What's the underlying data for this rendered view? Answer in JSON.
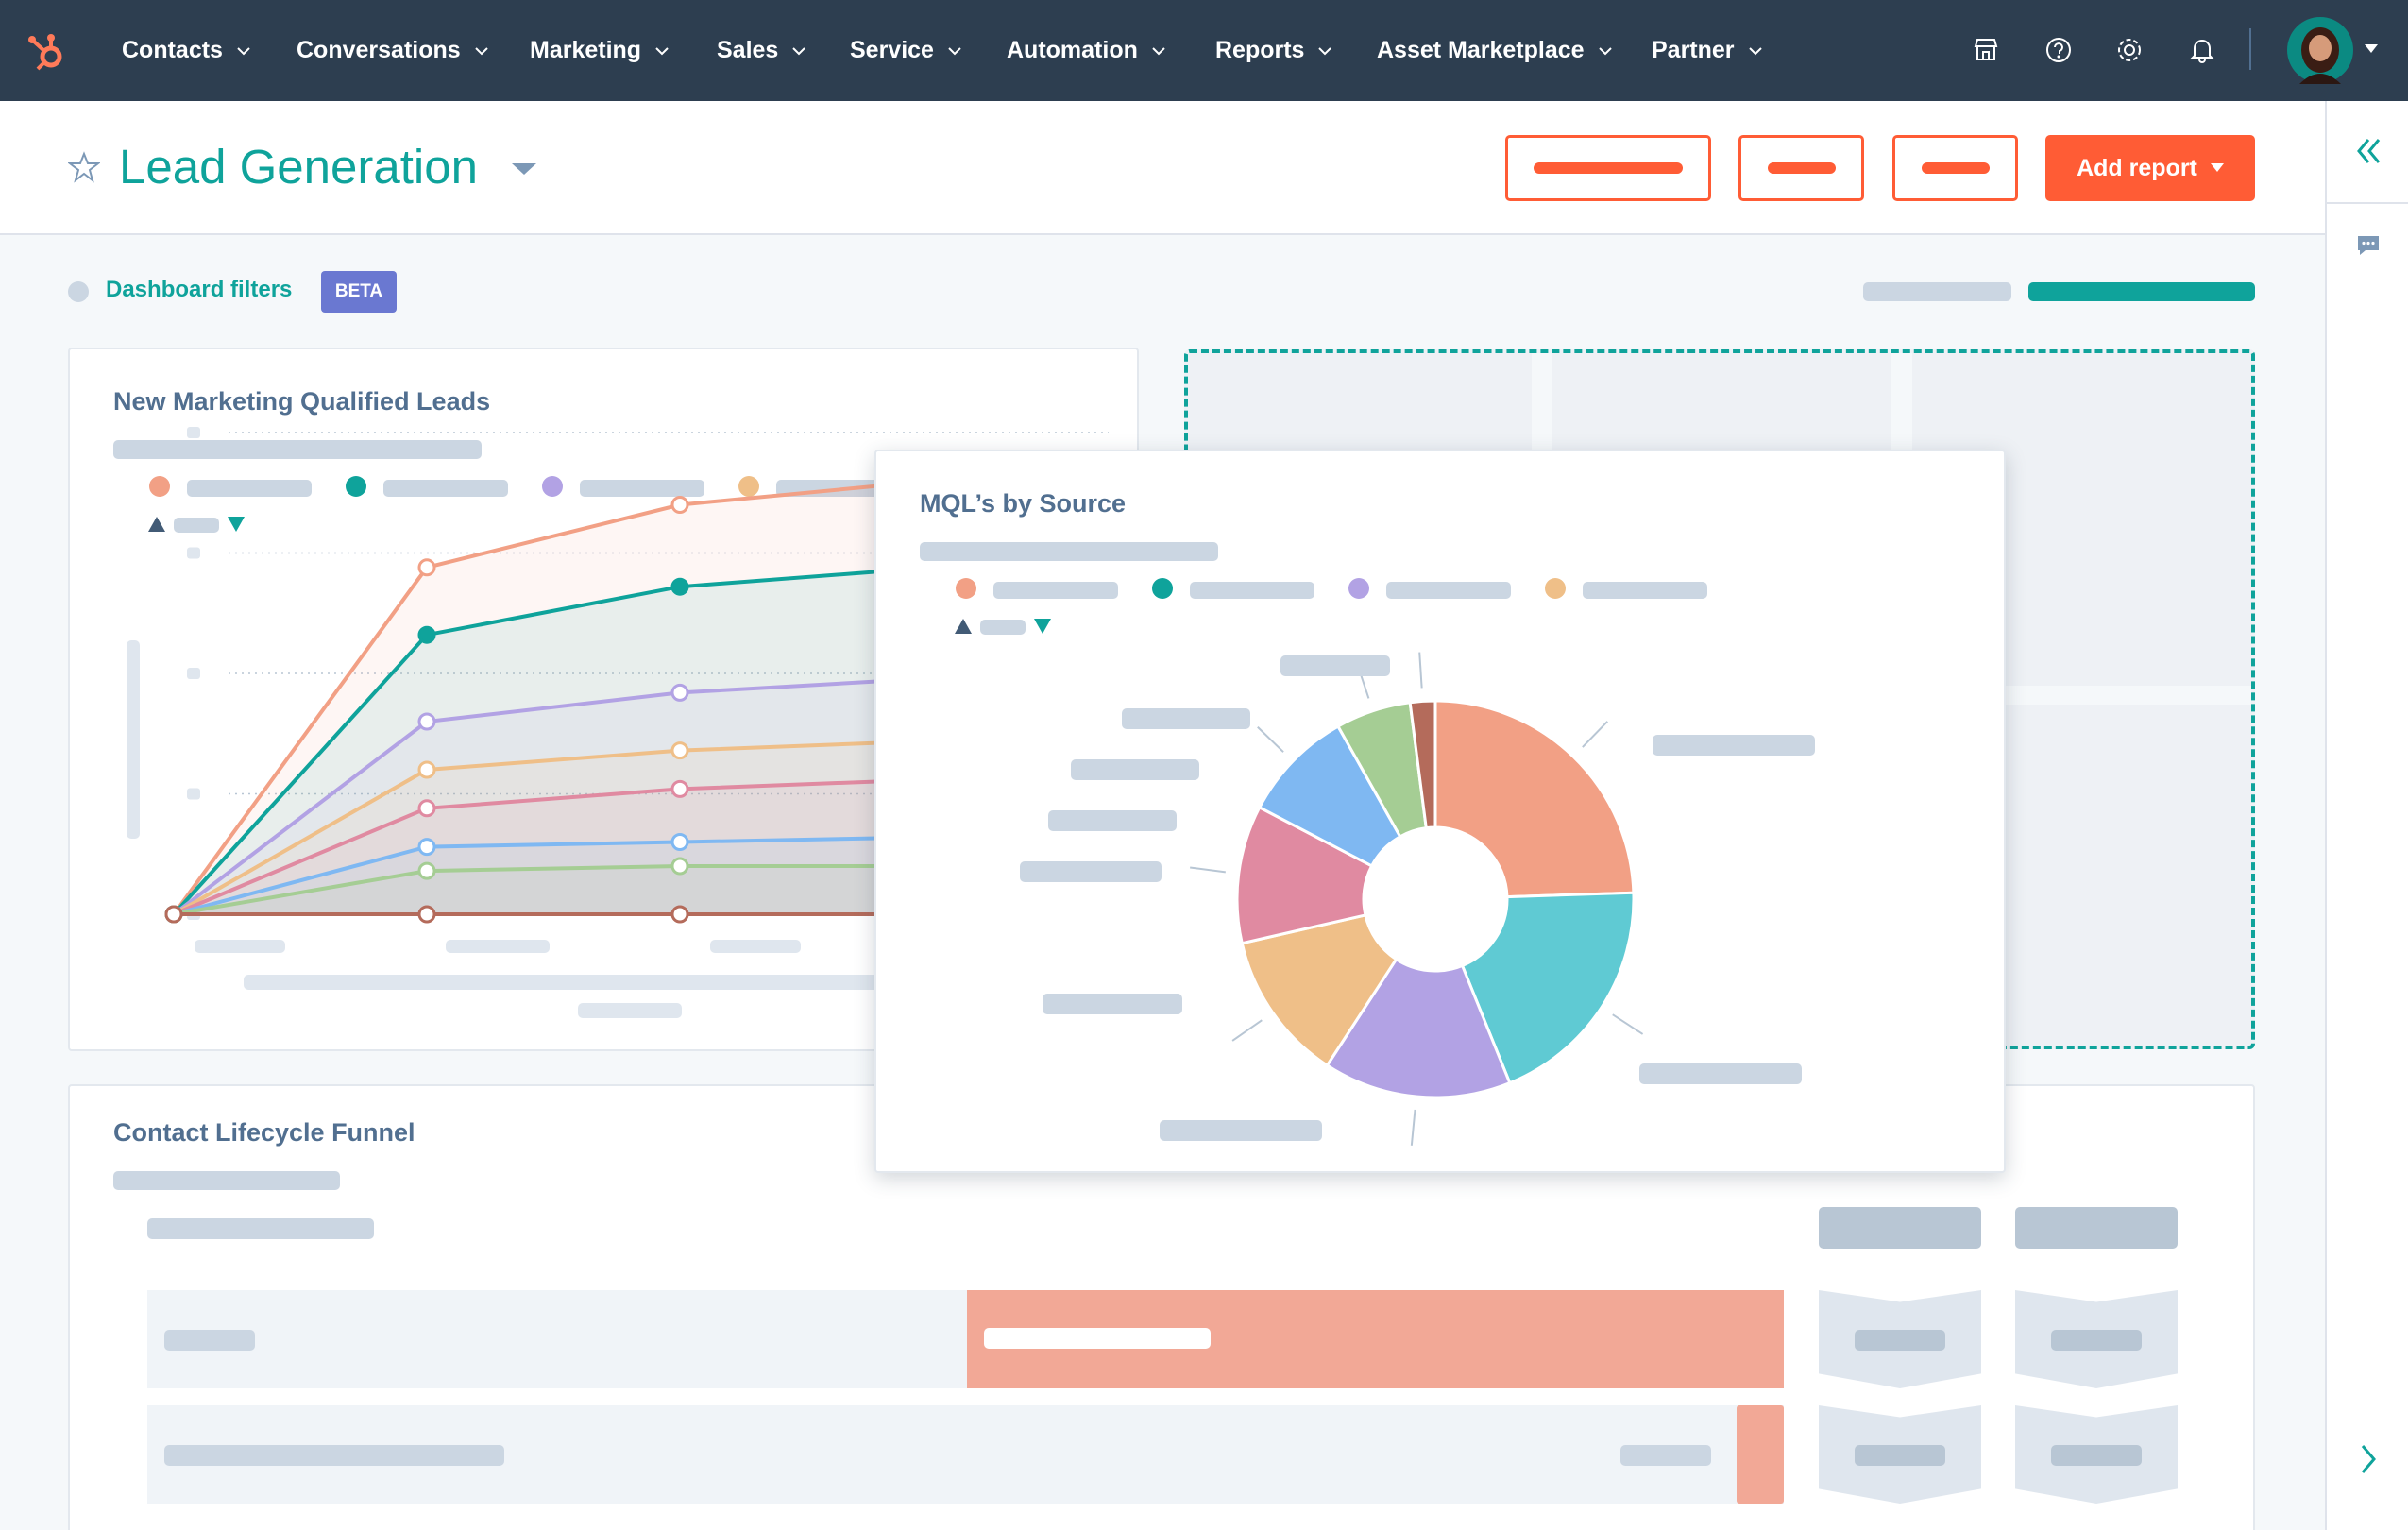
{
  "nav": {
    "items": [
      "Contacts",
      "Conversations",
      "Marketing",
      "Sales",
      "Service",
      "Automation",
      "Reports",
      "Asset Marketplace",
      "Partner"
    ],
    "icons": [
      "marketplace-icon",
      "help-icon",
      "settings-icon",
      "notifications-icon"
    ]
  },
  "header": {
    "title": "Lead Generation",
    "add_report_label": "Add report"
  },
  "filters": {
    "label": "Dashboard filters",
    "badge": "BETA"
  },
  "cards": {
    "mql_trend_title": "New Marketing Qualified Leads",
    "mql_source_title": "MQL’s by Source",
    "funnel_title": "Contact Lifecycle Funnel"
  },
  "colors": {
    "nav_bg": "#2d3e50",
    "accent_teal": "#0fa39b",
    "accent_orange": "#ff5c35",
    "badge": "#6a78d1"
  },
  "chart_data": [
    {
      "type": "line",
      "x": [
        0,
        1,
        2,
        3
      ],
      "series": [
        {
          "color": "#f2a085",
          "values": [
            0,
            72,
            85,
            90
          ]
        },
        {
          "color": "#0fa39b",
          "values": [
            0,
            58,
            68,
            72
          ]
        },
        {
          "color": "#b2a2e4",
          "values": [
            0,
            40,
            46,
            49
          ]
        },
        {
          "color": "#efbf88",
          "values": [
            0,
            30,
            34,
            36
          ]
        },
        {
          "color": "#e08aa1",
          "values": [
            0,
            22,
            26,
            28
          ]
        },
        {
          "color": "#7fb8f2",
          "values": [
            0,
            14,
            15,
            16
          ]
        },
        {
          "color": "#a5cd94",
          "values": [
            0,
            9,
            10,
            10
          ]
        },
        {
          "color": "#b46b5b",
          "values": [
            0,
            0,
            0,
            0
          ]
        }
      ],
      "ylim": [
        0,
        100
      ],
      "grid": true
    },
    {
      "type": "pie",
      "slices": [
        {
          "color": "#f2a085",
          "value": 24
        },
        {
          "color": "#5fcad3",
          "value": 19
        },
        {
          "color": "#b2a2e4",
          "value": 15
        },
        {
          "color": "#efbf88",
          "value": 12
        },
        {
          "color": "#e08aa1",
          "value": 11
        },
        {
          "color": "#7fb8f2",
          "value": 9
        },
        {
          "color": "#a5cd94",
          "value": 6
        },
        {
          "color": "#b46b5b",
          "value": 2
        }
      ],
      "donut": true
    }
  ]
}
